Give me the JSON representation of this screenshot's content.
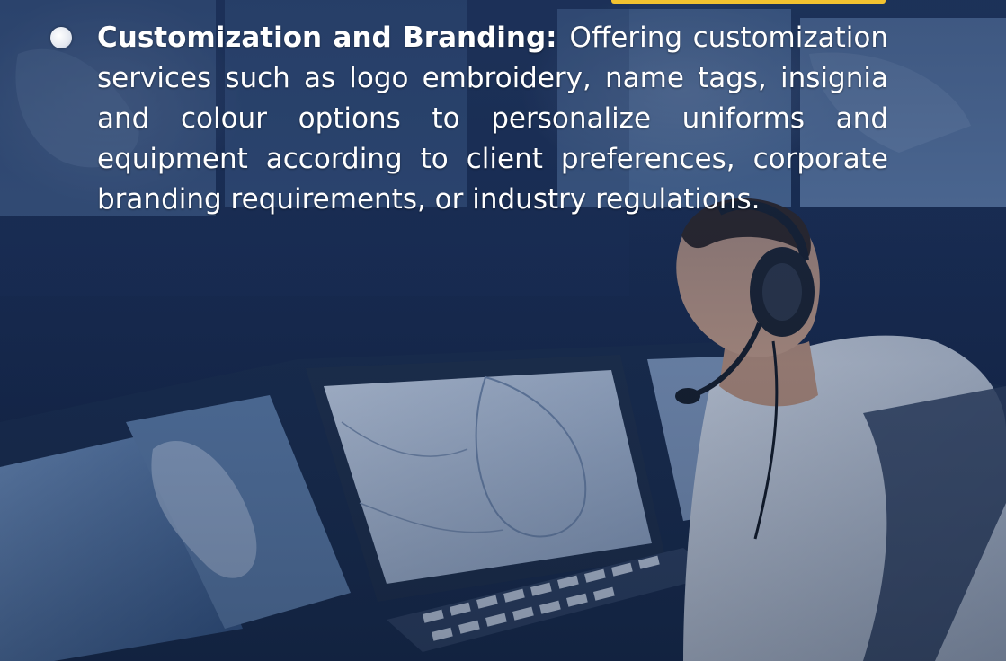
{
  "colors": {
    "text": "#ffffff",
    "bullet": "#ffffff",
    "accent": "#f2c230",
    "overlay": "#1c3159"
  },
  "content": {
    "heading": "Customization and Branding:",
    "body": "Offering customization services such as logo embroidery, name tags, insignia and colour options to personalize uniforms and equipment according to client preferences, corporate branding requirements, or industry regulations."
  },
  "background": {
    "scene": "control-room-operator-with-headset-and-map-monitors"
  }
}
